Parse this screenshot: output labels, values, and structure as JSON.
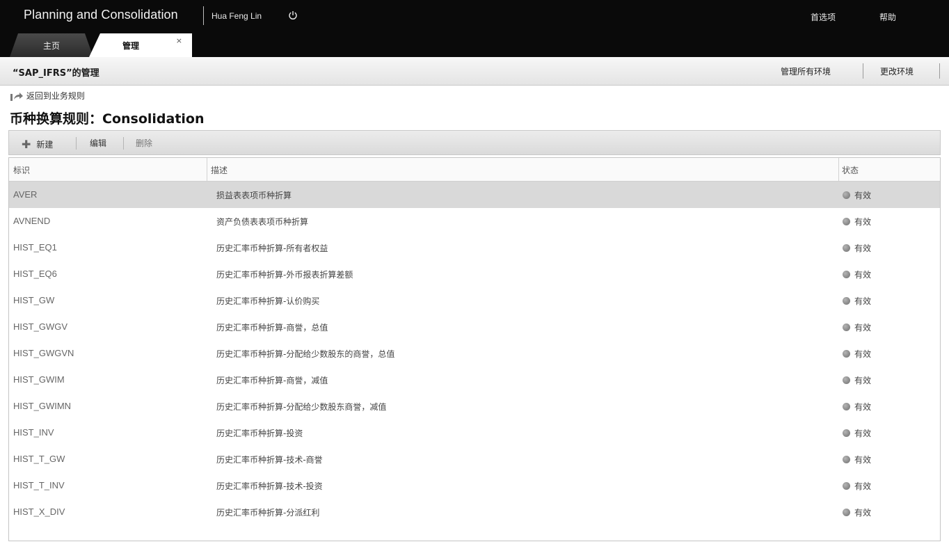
{
  "header": {
    "app_title": "Planning and Consolidation",
    "user_name": "Hua Feng Lin",
    "links": {
      "preferences": "首选项",
      "help": "帮助"
    },
    "tabs": {
      "home": "主页",
      "manage": "管理",
      "close_glyph": "×"
    }
  },
  "subheader": {
    "title": "“SAP_IFRS”的管理",
    "manage_all": "管理所有环境",
    "change_env": "更改环境"
  },
  "back_link": "返回到业务规则",
  "page_title": "币种换算规则：Consolidation",
  "toolbar": {
    "new": "新建",
    "edit": "编辑",
    "delete": "删除"
  },
  "table": {
    "columns": [
      "标识",
      "描述",
      "状态"
    ],
    "rows": [
      {
        "id": "AVER",
        "desc": "损益表表项币种折算",
        "status": "有效"
      },
      {
        "id": "AVNEND",
        "desc": "资产负债表表项币种折算",
        "status": "有效"
      },
      {
        "id": "HIST_EQ1",
        "desc": "历史汇率币种折算-所有者权益",
        "status": "有效"
      },
      {
        "id": "HIST_EQ6",
        "desc": "历史汇率币种折算-外币报表折算差额",
        "status": "有效"
      },
      {
        "id": "HIST_GW",
        "desc": "历史汇率币种折算-认价购买",
        "status": "有效"
      },
      {
        "id": "HIST_GWGV",
        "desc": "历史汇率币种折算-商誉，总值",
        "status": "有效"
      },
      {
        "id": "HIST_GWGVN",
        "desc": "历史汇率币种折算-分配给少数股东的商誉，总值",
        "status": "有效"
      },
      {
        "id": "HIST_GWIM",
        "desc": "历史汇率币种折算-商誉，减值",
        "status": "有效"
      },
      {
        "id": "HIST_GWIMN",
        "desc": "历史汇率币种折算-分配给少数股东商誉，减值",
        "status": "有效"
      },
      {
        "id": "HIST_INV",
        "desc": "历史汇率币种折算-投资",
        "status": "有效"
      },
      {
        "id": "HIST_T_GW",
        "desc": "历史汇率币种折算-技术-商誉",
        "status": "有效"
      },
      {
        "id": "HIST_T_INV",
        "desc": "历史汇率币种折算-技术-投资",
        "status": "有效"
      },
      {
        "id": "HIST_X_DIV",
        "desc": "历史汇率币种折算-分派红利",
        "status": "有效"
      }
    ],
    "selected_row": 0
  },
  "colors": {
    "topbar": "#0a0a0a",
    "selected_row": "#d9d9d9",
    "status_dot": "#8a8a8a"
  }
}
